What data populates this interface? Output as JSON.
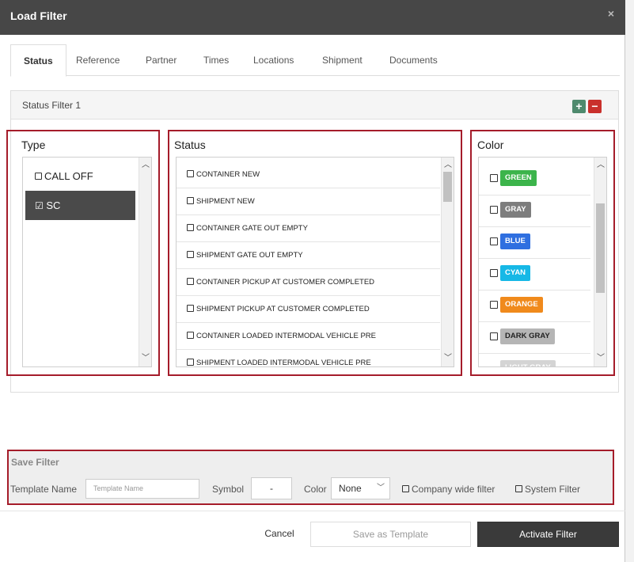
{
  "dialog": {
    "title": "Load Filter",
    "close": "×"
  },
  "tabs": [
    "Status",
    "Reference",
    "Partner",
    "Times",
    "Locations",
    "Shipment",
    "Documents"
  ],
  "panel": {
    "title": "Status Filter 1",
    "add": "+",
    "remove": "−"
  },
  "type_section": {
    "label": "Type",
    "items": [
      {
        "label": "CALL OFF",
        "checked": false
      },
      {
        "label": "SC",
        "checked": true
      }
    ]
  },
  "status_section": {
    "label": "Status",
    "items": [
      "CONTAINER NEW",
      "SHIPMENT NEW",
      "CONTAINER GATE OUT EMPTY",
      "SHIPMENT GATE OUT EMPTY",
      "CONTAINER PICKUP AT CUSTOMER COMPLETED",
      "SHIPMENT PICKUP AT CUSTOMER COMPLETED",
      "CONTAINER LOADED INTERMODAL VEHICLE PRE",
      "SHIPMENT LOADED INTERMODAL VEHICLE PRE"
    ]
  },
  "color_section": {
    "label": "Color",
    "items": [
      {
        "label": "GREEN",
        "color": "#3cb44b"
      },
      {
        "label": "GRAY",
        "color": "#7d7d7d"
      },
      {
        "label": "BLUE",
        "color": "#2f6fe0"
      },
      {
        "label": "CYAN",
        "color": "#16b8e6"
      },
      {
        "label": "ORANGE",
        "color": "#f08a1c"
      },
      {
        "label": "DARK GRAY",
        "color": "#b5b5b5"
      },
      {
        "label": "LIGHT GRAY",
        "color": "#d4d4d4"
      }
    ]
  },
  "save_filter": {
    "title": "Save Filter",
    "template_name_label": "Template Name",
    "template_name_placeholder": "Template Name",
    "symbol_label": "Symbol",
    "symbol_value": "-",
    "color_label": "Color",
    "color_value": "None",
    "company_wide_label": "Company wide filter",
    "system_filter_label": "System Filter"
  },
  "footer": {
    "cancel": "Cancel",
    "save_template": "Save as Template",
    "activate": "Activate Filter"
  }
}
